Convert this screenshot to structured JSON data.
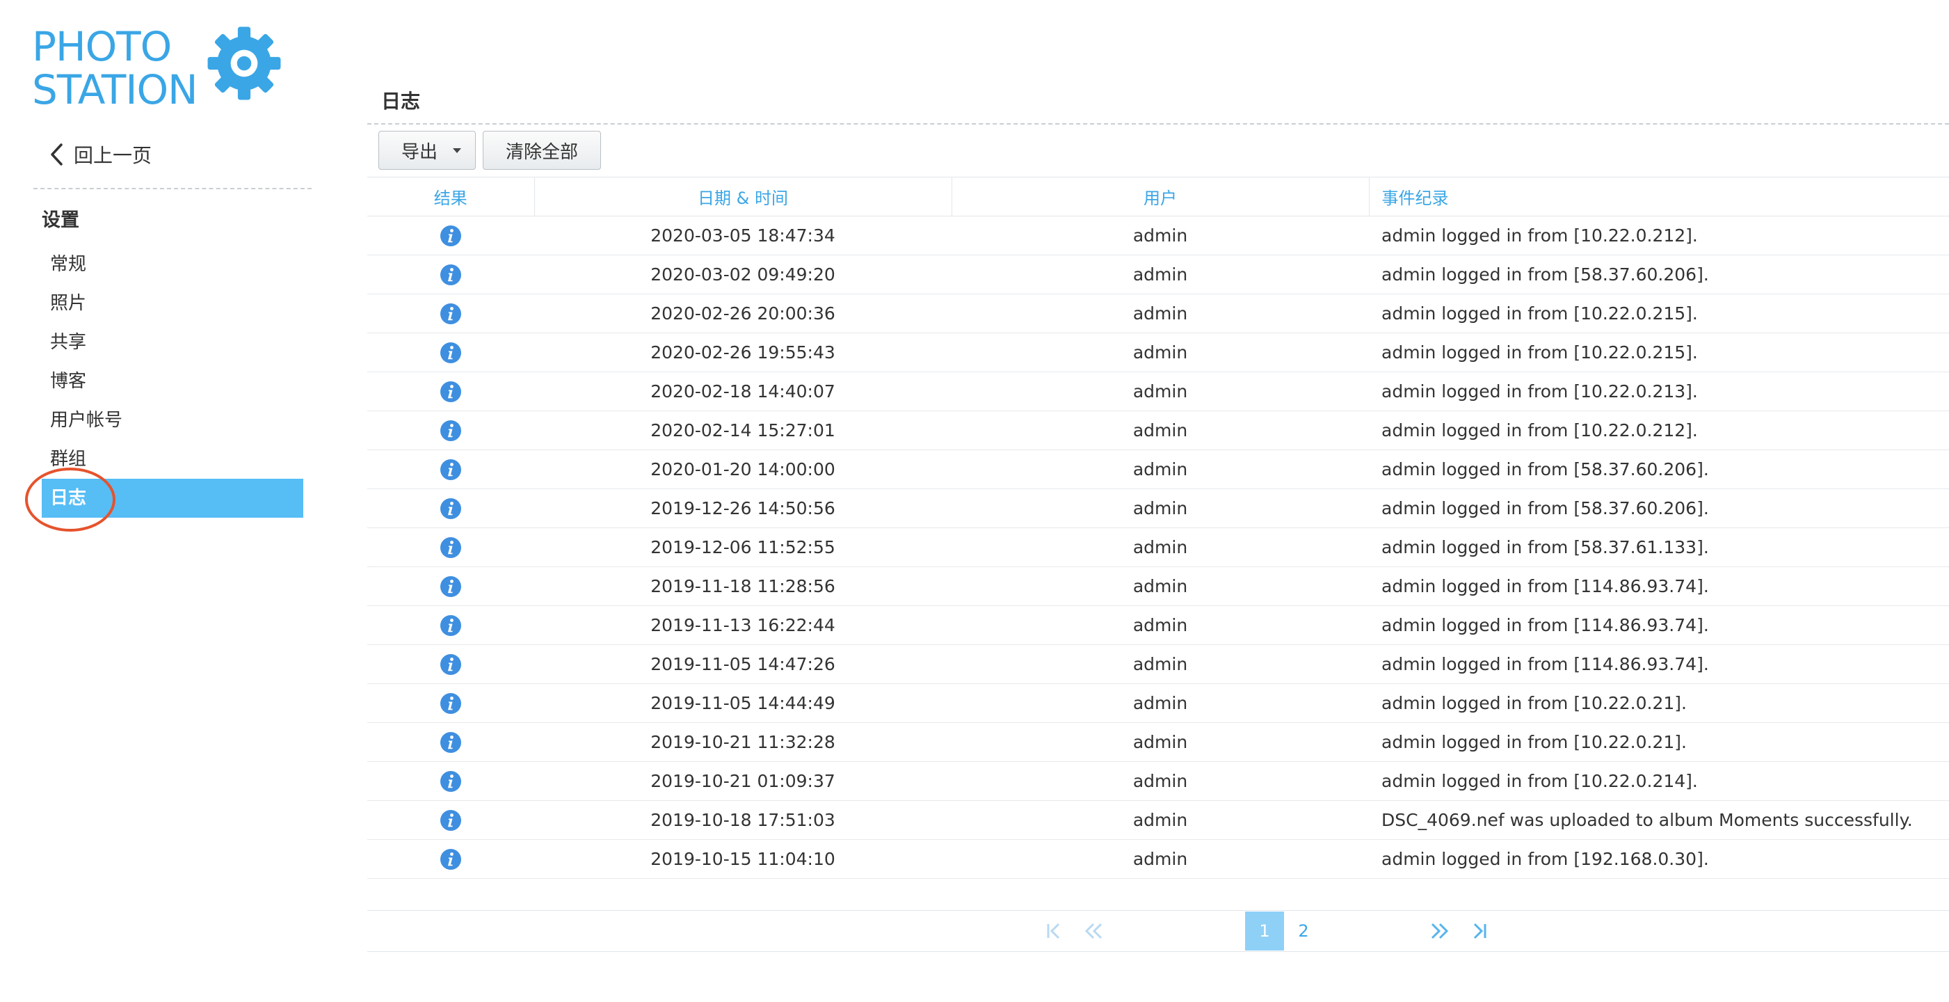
{
  "logo": {
    "line1": "PHOTO",
    "line2": "STATION",
    "icon": "gear-icon",
    "color": "#3aa6e6"
  },
  "sidebar": {
    "back_label": "回上一页",
    "heading": "设置",
    "items": [
      {
        "label": "常规",
        "active": false
      },
      {
        "label": "照片",
        "active": false
      },
      {
        "label": "共享",
        "active": false
      },
      {
        "label": "博客",
        "active": false
      },
      {
        "label": "用户帐号",
        "active": false
      },
      {
        "label": "群组",
        "active": false
      },
      {
        "label": "日志",
        "active": true
      }
    ],
    "active_color": "#56bdf5",
    "highlight_color": "#e5532d"
  },
  "main": {
    "title": "日志",
    "toolbar": {
      "export_label": "导出",
      "clear_label": "清除全部"
    },
    "table": {
      "columns": [
        "结果",
        "日期 & 时间",
        "用户",
        "事件纪录"
      ],
      "rows": [
        {
          "result": "info",
          "datetime": "2020-03-05 18:47:34",
          "user": "admin",
          "event": "admin logged in from [10.22.0.212]."
        },
        {
          "result": "info",
          "datetime": "2020-03-02 09:49:20",
          "user": "admin",
          "event": "admin logged in from [58.37.60.206]."
        },
        {
          "result": "info",
          "datetime": "2020-02-26 20:00:36",
          "user": "admin",
          "event": "admin logged in from [10.22.0.215]."
        },
        {
          "result": "info",
          "datetime": "2020-02-26 19:55:43",
          "user": "admin",
          "event": "admin logged in from [10.22.0.215]."
        },
        {
          "result": "info",
          "datetime": "2020-02-18 14:40:07",
          "user": "admin",
          "event": "admin logged in from [10.22.0.213]."
        },
        {
          "result": "info",
          "datetime": "2020-02-14 15:27:01",
          "user": "admin",
          "event": "admin logged in from [10.22.0.212]."
        },
        {
          "result": "info",
          "datetime": "2020-01-20 14:00:00",
          "user": "admin",
          "event": "admin logged in from [58.37.60.206]."
        },
        {
          "result": "info",
          "datetime": "2019-12-26 14:50:56",
          "user": "admin",
          "event": "admin logged in from [58.37.60.206]."
        },
        {
          "result": "info",
          "datetime": "2019-12-06 11:52:55",
          "user": "admin",
          "event": "admin logged in from [58.37.61.133]."
        },
        {
          "result": "info",
          "datetime": "2019-11-18 11:28:56",
          "user": "admin",
          "event": "admin logged in from [114.86.93.74]."
        },
        {
          "result": "info",
          "datetime": "2019-11-13 16:22:44",
          "user": "admin",
          "event": "admin logged in from [114.86.93.74]."
        },
        {
          "result": "info",
          "datetime": "2019-11-05 14:47:26",
          "user": "admin",
          "event": "admin logged in from [114.86.93.74]."
        },
        {
          "result": "info",
          "datetime": "2019-11-05 14:44:49",
          "user": "admin",
          "event": "admin logged in from [10.22.0.21]."
        },
        {
          "result": "info",
          "datetime": "2019-10-21 11:32:28",
          "user": "admin",
          "event": "admin logged in from [10.22.0.21]."
        },
        {
          "result": "info",
          "datetime": "2019-10-21 01:09:37",
          "user": "admin",
          "event": "admin logged in from [10.22.0.214]."
        },
        {
          "result": "info",
          "datetime": "2019-10-18 17:51:03",
          "user": "admin",
          "event": "DSC_4069.nef was uploaded to album Moments successfully."
        },
        {
          "result": "info",
          "datetime": "2019-10-15 11:04:10",
          "user": "admin",
          "event": "admin logged in from [192.168.0.30]."
        }
      ],
      "info_icon_color": "#3f8fe0"
    },
    "pager": {
      "pages": [
        "1",
        "2"
      ],
      "current": "1",
      "icons": [
        "first-page-icon",
        "prev-page-icon",
        "next-page-icon",
        "last-page-icon"
      ]
    }
  }
}
